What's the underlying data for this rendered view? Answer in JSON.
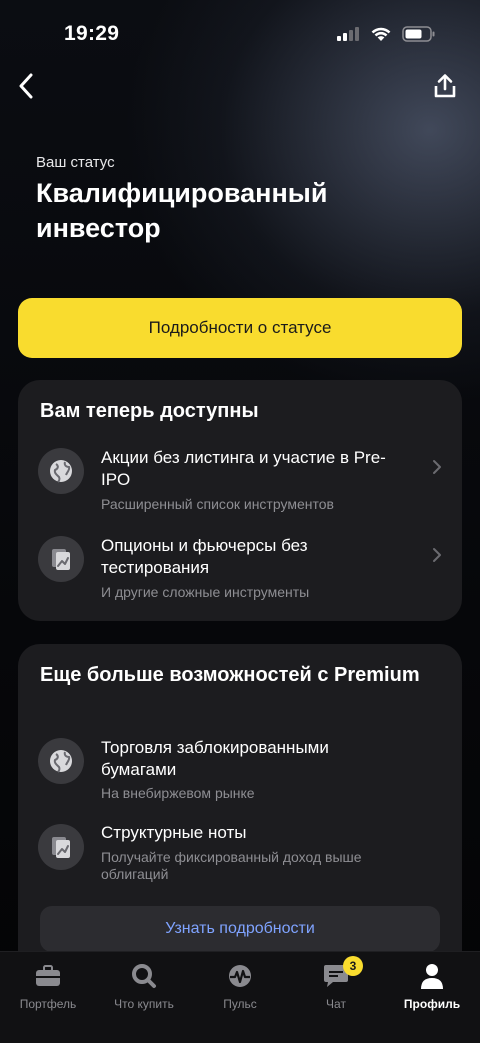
{
  "status_bar": {
    "time": "19:29"
  },
  "header": {
    "subtitle": "Ваш статус",
    "title": "Квалифицированный инвестор"
  },
  "primary_button": {
    "label": "Подробности о статусе"
  },
  "available_card": {
    "title": "Вам теперь доступны",
    "items": [
      {
        "title": "Акции без листинга и участие в Pre-IPO",
        "subtitle": "Расширенный список инструментов",
        "icon": "globe-icon"
      },
      {
        "title": "Опционы и фьючерсы без тестирования",
        "subtitle": "И другие сложные инструменты",
        "icon": "chart-document-icon"
      }
    ]
  },
  "premium_card": {
    "title": "Еще больше возможностей с Premium",
    "items": [
      {
        "title": "Торговля заблокированными бумагами",
        "subtitle": "На внебиржевом рынке",
        "icon": "globe-icon"
      },
      {
        "title": "Структурные ноты",
        "subtitle": "Получайте фиксированный доход выше облигаций",
        "icon": "chart-document-icon"
      }
    ],
    "button_label": "Узнать подробности"
  },
  "tabbar": {
    "tabs": [
      {
        "label": "Портфель",
        "icon": "briefcase-icon"
      },
      {
        "label": "Что купить",
        "icon": "search-icon"
      },
      {
        "label": "Пульс",
        "icon": "pulse-icon"
      },
      {
        "label": "Чат",
        "icon": "chat-icon",
        "badge": "3"
      },
      {
        "label": "Профиль",
        "icon": "profile-icon",
        "active": true
      }
    ]
  },
  "colors": {
    "accent": "#f9dc2e",
    "link": "#7fa3ff",
    "card": "#1c1c1f"
  }
}
